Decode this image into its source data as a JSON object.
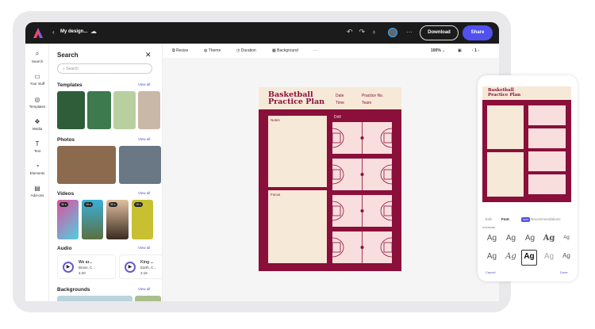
{
  "topbar": {
    "title": "My design...",
    "download": "Download",
    "share": "Share"
  },
  "rail": [
    {
      "label": "Search",
      "icon": "search-icon"
    },
    {
      "label": "Your stuff",
      "icon": "folder-icon"
    },
    {
      "label": "Templates",
      "icon": "templates-icon"
    },
    {
      "label": "Media",
      "icon": "media-icon"
    },
    {
      "label": "Text",
      "icon": "text-icon"
    },
    {
      "label": "Elements",
      "icon": "elements-icon"
    },
    {
      "label": "Add-ons",
      "icon": "addons-icon"
    }
  ],
  "panel": {
    "title": "Search",
    "search_placeholder": "Search",
    "view_all": "View all",
    "sections": {
      "templates": "Templates",
      "photos": "Photos",
      "videos": "Videos",
      "audio": "Audio",
      "backgrounds": "Backgrounds"
    },
    "videos": [
      "30 s",
      "15 s",
      "30 s",
      "15 s"
    ],
    "audio": [
      {
        "title": "We ar...",
        "artist": "Bross, C...",
        "duration": "4:20"
      },
      {
        "title": "King ...",
        "artist": "Earth, C...",
        "duration": "2:15"
      }
    ]
  },
  "toolbar": {
    "resize": "Resize",
    "theme": "Theme",
    "duration": "Duration",
    "background": "Background",
    "zoom": "100%",
    "page": "1"
  },
  "doc": {
    "title_line1": "Basketball",
    "title_line2": "Practice Plan",
    "date": "Date",
    "time": "Time",
    "practice_no": "Practice No.",
    "team": "Team",
    "notes": "Notes",
    "focus": "Focus",
    "drill": "Drill"
  },
  "phone": {
    "tabs": {
      "edit": "Edit",
      "font": "Font",
      "new": "NEW",
      "recommendations": "Recommendations"
    },
    "standard": "STANDARD",
    "cancel": "Cancel",
    "done": "Done",
    "font_sample": "Ag"
  },
  "colors": {
    "accent": "#5151f0",
    "maroon": "#8a0f3a",
    "cream": "#f7e9d8"
  }
}
